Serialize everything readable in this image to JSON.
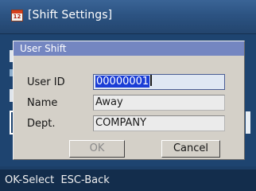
{
  "screen": {
    "title": "[Shift Settings]",
    "icon": "calendar-icon",
    "icon_text": "12"
  },
  "dialog": {
    "title": "User Shift",
    "fields": [
      {
        "label": "User ID",
        "value_selected": "00000001"
      },
      {
        "label": "Name",
        "value": "Away"
      },
      {
        "label": "Dept.",
        "value": "COMPANY"
      }
    ],
    "ok_label": "OK",
    "cancel_label": "Cancel"
  },
  "footer": {
    "hint": "OK-Select  ESC-Back"
  },
  "colors": {
    "title_bar": "#2c5382",
    "dialog_title_bar": "#7486c1",
    "dialog_body": "#d4d0c8",
    "selection": "#1a3dd6"
  }
}
